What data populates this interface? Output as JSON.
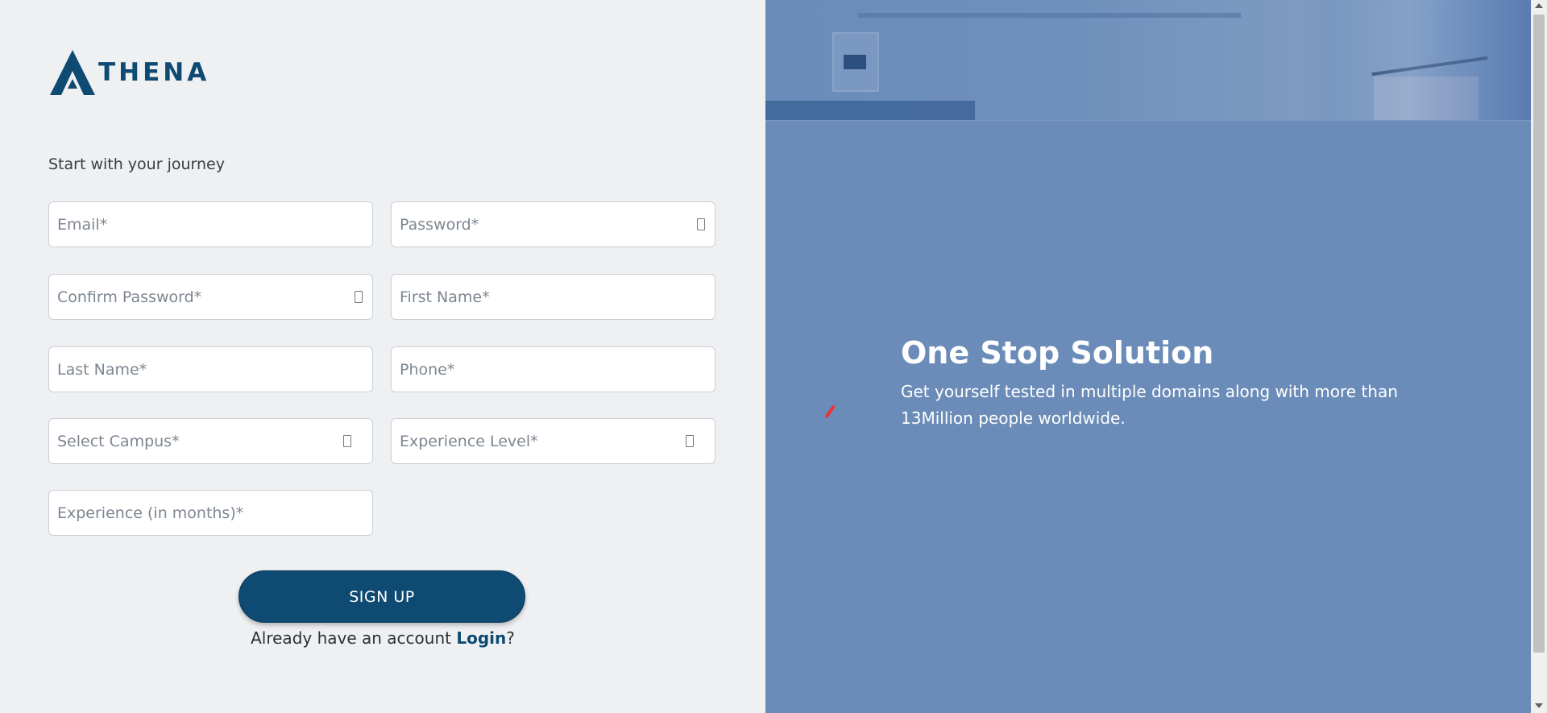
{
  "brand": {
    "name": "THENA",
    "logo_icon": "athena-triangle-logo",
    "accent_color": "#0e4a72"
  },
  "form": {
    "heading": "Start with your journey",
    "fields": {
      "email": {
        "placeholder": "Email*"
      },
      "password": {
        "placeholder": "Password*",
        "icon": "eye-toggle-icon"
      },
      "confirm_password": {
        "placeholder": "Confirm Password*",
        "icon": "eye-toggle-icon"
      },
      "first_name": {
        "placeholder": "First Name*"
      },
      "last_name": {
        "placeholder": "Last Name*"
      },
      "phone": {
        "placeholder": "Phone*"
      },
      "campus": {
        "placeholder": "Select Campus*",
        "icon": "dropdown-icon"
      },
      "experience_level": {
        "placeholder": "Experience Level*",
        "icon": "dropdown-icon"
      },
      "experience_months": {
        "placeholder": "Experience (in months)*"
      }
    },
    "signup_label": "SIGN UP",
    "login_prompt": "Already have an account",
    "login_link": "Login",
    "login_suffix": "?"
  },
  "hero": {
    "title": "One Stop Solution",
    "text": "Get yourself tested in multiple domains along with more than 13Million people worldwide.",
    "background_color": "#6b8cb8"
  }
}
